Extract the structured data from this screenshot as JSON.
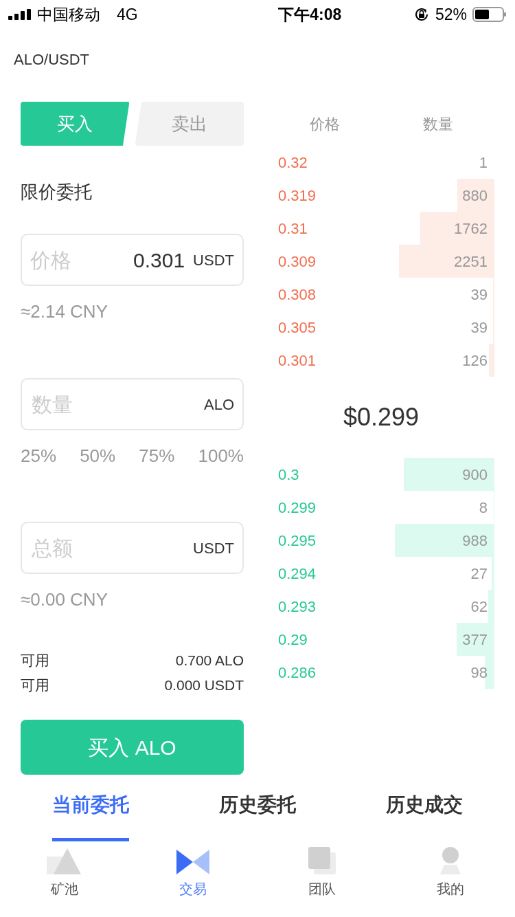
{
  "status_bar": {
    "carrier": "中国移动",
    "network": "4G",
    "time": "下午4:08",
    "battery_text": "52%"
  },
  "pair": "ALO/USDT",
  "side_tabs": [
    {
      "label": "买入",
      "selected": true
    },
    {
      "label": "卖出",
      "selected": false
    }
  ],
  "order_type": "限价委托",
  "price_field": {
    "placeholder": "价格",
    "value": "0.301",
    "unit": "USDT"
  },
  "price_cny": "≈2.14 CNY",
  "amount_field": {
    "placeholder": "数量",
    "unit": "ALO"
  },
  "percent_options": [
    "25%",
    "50%",
    "75%",
    "100%"
  ],
  "total_field": {
    "placeholder": "总额",
    "unit": "USDT"
  },
  "total_cny": "≈0.00 CNY",
  "balances": [
    {
      "label": "可用",
      "value": "0.700 ALO"
    },
    {
      "label": "可用",
      "value": "0.000 USDT"
    }
  ],
  "submit_button": "买入 ALO",
  "order_book": {
    "columns": [
      "价格",
      "数量"
    ],
    "asks": [
      {
        "price": "0.32",
        "amount": "1"
      },
      {
        "price": "0.319",
        "amount": "880"
      },
      {
        "price": "0.31",
        "amount": "1762"
      },
      {
        "price": "0.309",
        "amount": "2251"
      },
      {
        "price": "0.308",
        "amount": "39"
      },
      {
        "price": "0.305",
        "amount": "39"
      },
      {
        "price": "0.301",
        "amount": "126"
      }
    ],
    "last_price": "$0.299",
    "bids": [
      {
        "price": "0.3",
        "amount": "900"
      },
      {
        "price": "0.299",
        "amount": "8"
      },
      {
        "price": "0.295",
        "amount": "988"
      },
      {
        "price": "0.294",
        "amount": "27"
      },
      {
        "price": "0.293",
        "amount": "62"
      },
      {
        "price": "0.29",
        "amount": "377"
      },
      {
        "price": "0.286",
        "amount": "98"
      }
    ]
  },
  "order_tabs": [
    {
      "label": "当前委托",
      "selected": true
    },
    {
      "label": "历史委托",
      "selected": false
    },
    {
      "label": "历史成交",
      "selected": false
    }
  ],
  "bottom_nav": [
    {
      "label": "矿池",
      "kind": "pool",
      "selected": false
    },
    {
      "label": "交易",
      "kind": "trade",
      "selected": true
    },
    {
      "label": "团队",
      "kind": "team",
      "selected": false
    },
    {
      "label": "我的",
      "kind": "profile",
      "selected": false
    }
  ]
}
